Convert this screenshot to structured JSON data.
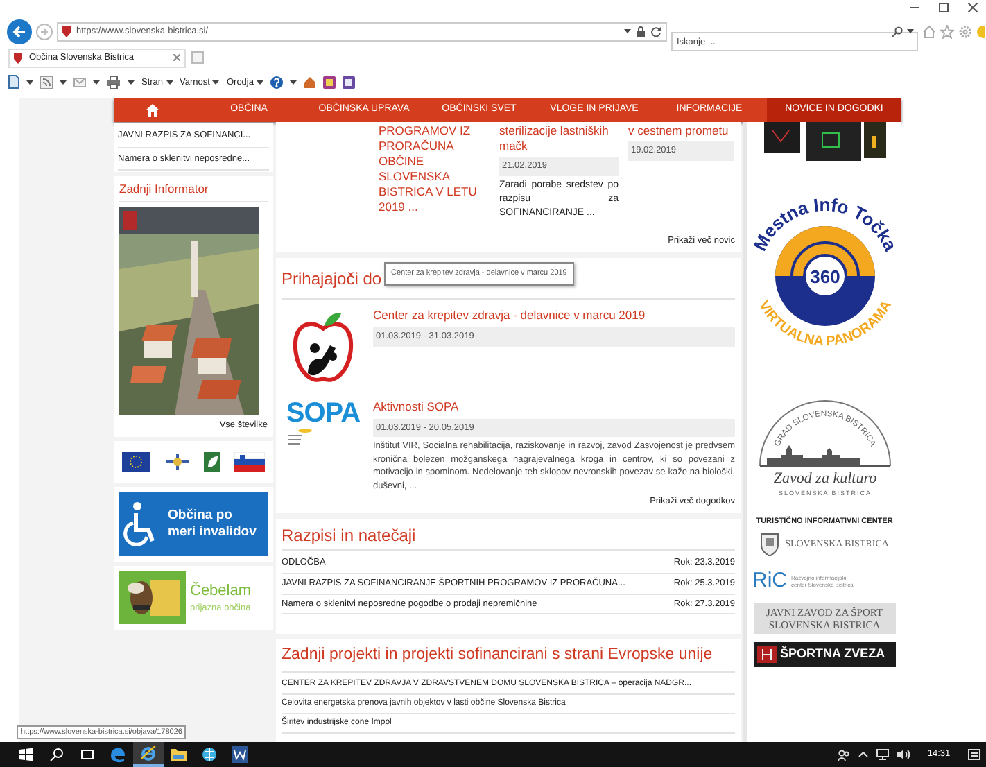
{
  "address_bar": {
    "url": "https://www.slovenska-bistrica.si/",
    "search_placeholder": "Iskanje ..."
  },
  "tabs": [
    {
      "label": "Občina Slovenska Bistrica",
      "selected": true
    }
  ],
  "command_bar": {
    "menus": [
      "Stran",
      "Varnost",
      "Orodja"
    ]
  },
  "nav": [
    {
      "kind": "home",
      "selected": false
    },
    {
      "kind": "link",
      "label": "OBČINA",
      "selected": false
    },
    {
      "kind": "link",
      "label": "OBČINSKA UPRAVA",
      "selected": false
    },
    {
      "kind": "link",
      "label": "OBČINSKI SVET",
      "selected": false
    },
    {
      "kind": "link",
      "label": "VLOGE IN PRIJAVE",
      "selected": false
    },
    {
      "kind": "link",
      "label": "INFORMACIJE",
      "selected": false
    },
    {
      "kind": "link",
      "label": "NOVICE IN DOGODKI",
      "selected": true
    }
  ],
  "left_column": {
    "links": [
      "JAVNI RAZPIS ZA SOFINANCI...",
      "Namera o sklenitvi neposredne..."
    ],
    "informator": {
      "title": "Zadnji Informator",
      "more": "Vse številke"
    },
    "accessibility_banner": "Občina po meri invalidov",
    "bee_banner": {
      "title": "Čebelam",
      "subtitle": "prijazna občina"
    }
  },
  "news": [
    {
      "title": "PROGRAMOV IZ PRORAČUNA OBČINE SLOVENSKA BISTRICA V LETU 2019 ..."
    },
    {
      "title": "sterilizacije lastniških mačk",
      "date": "21.02.2019",
      "summary": "Zaradi porabe sredstev po razpisu za SOFINANCIRANJE ..."
    },
    {
      "title": "v cestnem prometu",
      "date": "19.02.2019"
    }
  ],
  "news_more": "Prikaži več novic",
  "events": {
    "title": "Prihajajoči do",
    "tooltip": "Center za krepitev zdravja - delavnice v marcu 2019",
    "items": [
      {
        "kind": "apple",
        "title": "Center za krepitev zdravja - delavnice v marcu 2019",
        "date": "01.03.2019 - 31.03.2019"
      },
      {
        "kind": "sopa",
        "logo_text": "SOPA",
        "title": "Aktivnosti SOPA",
        "date": "01.03.2019 - 20.05.2019",
        "summary": "Inštitut VIR, Socialna rehabilitacija, raziskovanje in razvoj, zavod Zasvojenost je predvsem kronična bolezen možganskega nagrajevalnega kroga in centrov, ki so povezani z motivacijo in spominom. Nedelovanje teh sklopov nevronskih povezav se kaže na biološki, duševni, ..."
      }
    ],
    "more": "Prikaži več dogodkov"
  },
  "tenders": {
    "title": "Razpisi in natečaji",
    "rows": [
      {
        "name": "ODLOČBA",
        "deadline": "Rok: 23.3.2019"
      },
      {
        "name": "JAVNI RAZPIS ZA SOFINANCIRANJE ŠPORTNIH PROGRAMOV IZ PRORAČUNA...",
        "deadline": "Rok: 25.3.2019"
      },
      {
        "name": "Namera o sklenitvi neposredne pogodbe o prodaji nepremičnine",
        "deadline": "Rok: 27.3.2019"
      }
    ]
  },
  "projects": {
    "title": "Zadnji projekti in projekti sofinancirani s strani Evropske unije",
    "rows": [
      "CENTER ZA KREPITEV ZDRAVJA V ZDRAVSTVENEM DOMU SLOVENSKA BISTRICA – operacija NADGR...",
      "Celovita energetska prenova javnih objektov v lasti občine Slovenska Bistrica",
      "Širitev industrijske cone Impol"
    ]
  },
  "right_column": {
    "panorama": {
      "top": "Mestna Info Točka",
      "center": "360",
      "bottom": "VIRTUALNA PANORAMA"
    },
    "culture": {
      "arc": "GRAD SLOVENSKA BISTRICA",
      "name": "Zavod za kulturo",
      "place": "SLOVENSKA BISTRICA"
    },
    "tic": {
      "heading": "TURISTIČNO INFORMATIVNI CENTER",
      "place": "SLOVENSKA BISTRICA"
    },
    "ric": {
      "logo": "RiC",
      "caption": "Razvojno informacijski center Slovenska Bistrica"
    },
    "sport_institute": "JAVNI ZAVOD ZA ŠPORT SLOVENSKA BISTRICA",
    "sport_union": "ŠPORTNA ZVEZA"
  },
  "status_url": "https://www.slovenska-bistrica.si/objava/178026",
  "taskbar": {
    "apps": [
      {
        "kind": "start",
        "selected": false
      },
      {
        "kind": "search",
        "selected": false
      },
      {
        "kind": "taskview",
        "selected": false
      },
      {
        "kind": "edge",
        "selected": false
      },
      {
        "kind": "ie",
        "selected": true
      },
      {
        "kind": "folder",
        "selected": false
      },
      {
        "kind": "globe",
        "selected": false
      },
      {
        "kind": "word",
        "selected": false
      }
    ],
    "time": "14:31"
  }
}
